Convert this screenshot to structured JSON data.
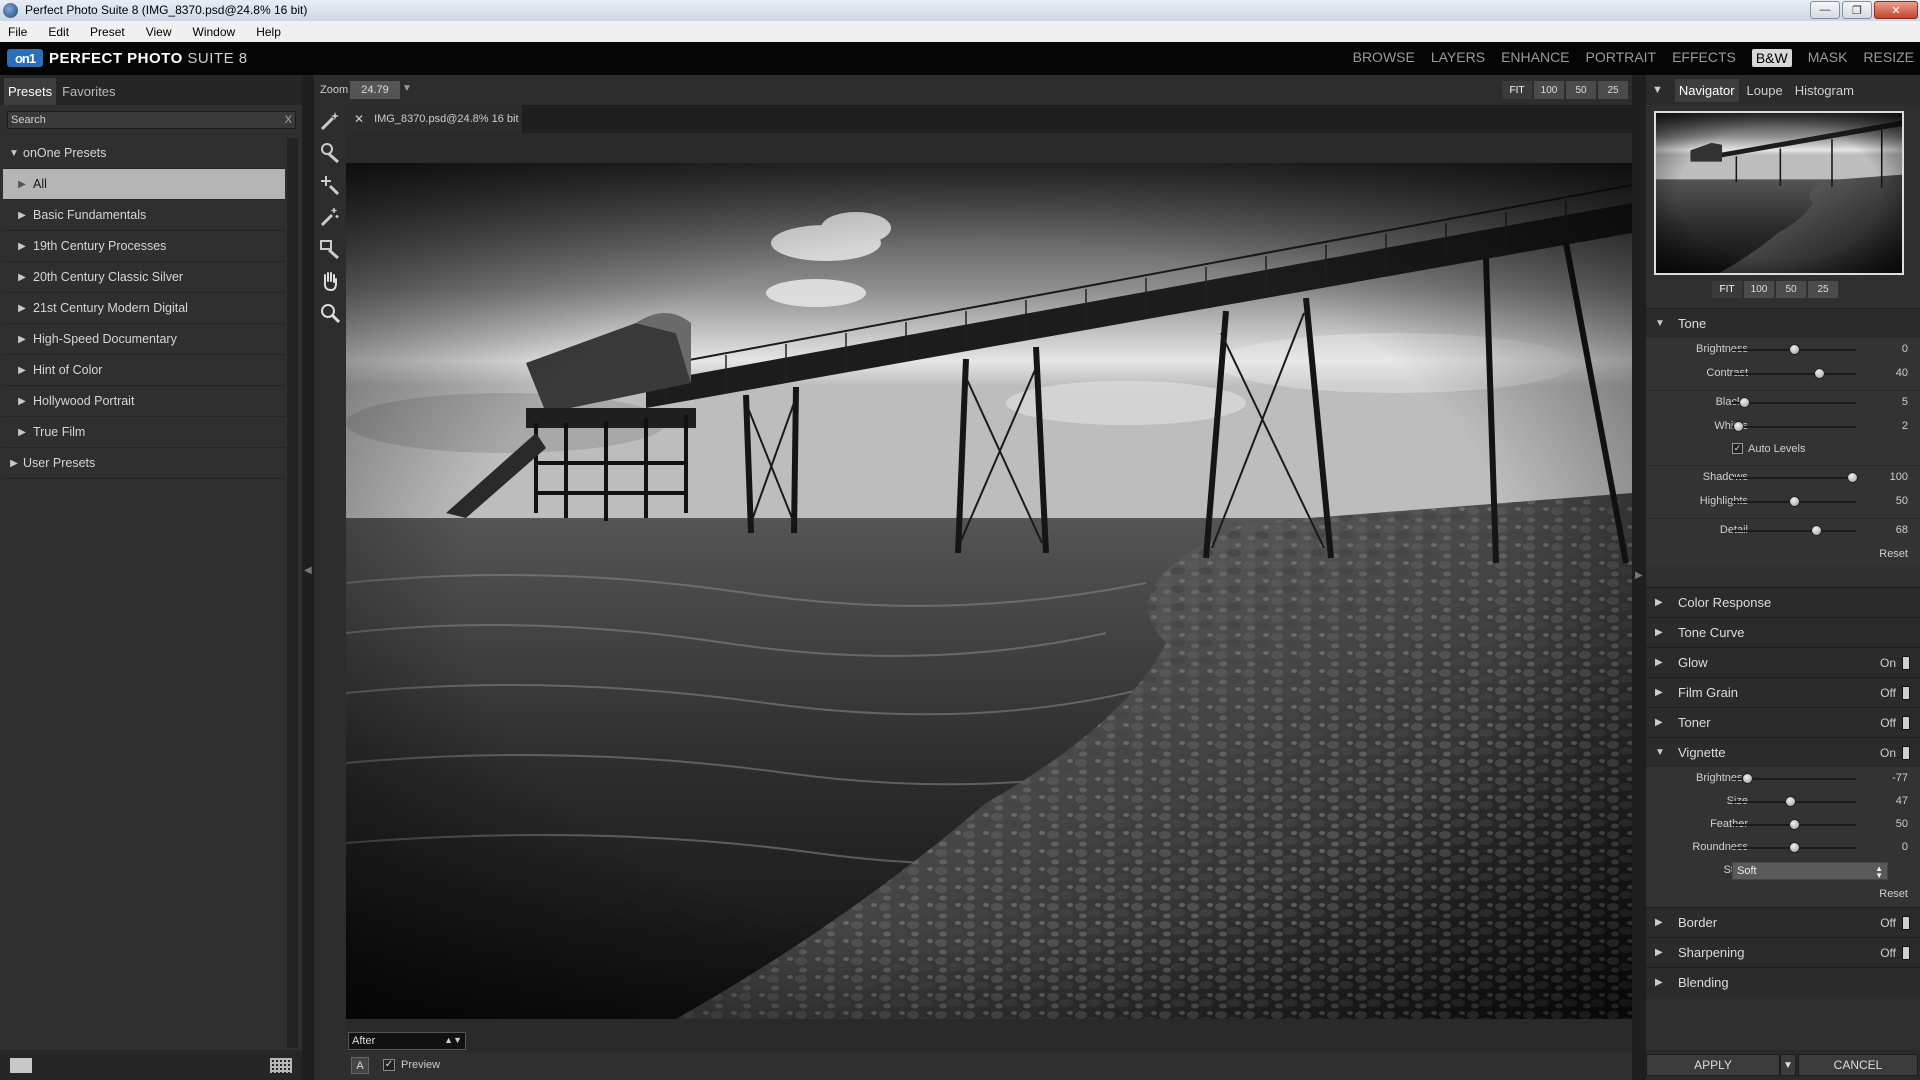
{
  "window": {
    "title": "Perfect Photo Suite 8 (IMG_8370.psd@24.8% 16 bit)"
  },
  "menu": [
    "File",
    "Edit",
    "Preset",
    "View",
    "Window",
    "Help"
  ],
  "app": {
    "logo_mark": "on1",
    "name_bold": "PERFECT PHOTO",
    "name_light": " SUITE 8",
    "modules": [
      "BROWSE",
      "LAYERS",
      "ENHANCE",
      "PORTRAIT",
      "EFFECTS",
      "B&W",
      "MASK",
      "RESIZE"
    ],
    "active_module": "B&W"
  },
  "left": {
    "tabs": [
      "Presets",
      "Favorites"
    ],
    "search_placeholder": "Search",
    "search_clear": "X",
    "root": "onOne Presets",
    "items": [
      "All",
      "Basic Fundamentals",
      "19th Century Processes",
      "20th Century Classic Silver",
      "21st Century Modern Digital",
      "High-Speed Documentary",
      "Hint of Color",
      "Hollywood Portrait",
      "True Film"
    ],
    "user": "User Presets"
  },
  "canvas": {
    "zoom_label": "Zoom",
    "zoom_value": "24.79",
    "zoom_buttons": [
      "FIT",
      "100",
      "50",
      "25"
    ],
    "doc_tab": "IMG_8370.psd@24.8% 16 bit",
    "view_mode": "After",
    "compare_label": "A",
    "preview_label": "Preview"
  },
  "navigator": {
    "tabs": [
      "Navigator",
      "Loupe",
      "Histogram"
    ],
    "zoom_buttons": [
      "FIT",
      "100",
      "50",
      "25"
    ]
  },
  "tone": {
    "title": "Tone",
    "brightness": {
      "label": "Brightness",
      "value": "0",
      "pos": 0.5
    },
    "contrast": {
      "label": "Contrast",
      "value": "40",
      "pos": 0.7
    },
    "blacks": {
      "label": "Blacks",
      "value": "5",
      "pos": 0.1
    },
    "whites": {
      "label": "Whites",
      "value": "2",
      "pos": 0.05
    },
    "auto_levels": "Auto Levels",
    "shadows": {
      "label": "Shadows",
      "value": "100",
      "pos": 0.97
    },
    "highlights": {
      "label": "Highlights",
      "value": "50",
      "pos": 0.5
    },
    "detail": {
      "label": "Detail",
      "value": "68",
      "pos": 0.68
    },
    "reset": "Reset"
  },
  "sections": {
    "color_response": "Color Response",
    "tone_curve": "Tone Curve",
    "glow": {
      "title": "Glow",
      "state": "On"
    },
    "film_grain": {
      "title": "Film Grain",
      "state": "Off"
    },
    "toner": {
      "title": "Toner",
      "state": "Off"
    },
    "vignette": {
      "title": "Vignette",
      "state": "On"
    },
    "border": {
      "title": "Border",
      "state": "Off"
    },
    "sharpening": {
      "title": "Sharpening",
      "state": "Off"
    },
    "blending": "Blending"
  },
  "vignette": {
    "brightness": {
      "label": "Brightness",
      "value": "-77",
      "pos": 0.12
    },
    "size": {
      "label": "Size",
      "value": "47",
      "pos": 0.47
    },
    "feather": {
      "label": "Feather",
      "value": "50",
      "pos": 0.5
    },
    "roundness": {
      "label": "Roundness",
      "value": "0",
      "pos": 0.5
    },
    "style_label": "Style",
    "style_value": "Soft",
    "reset": "Reset"
  },
  "actions": {
    "apply": "APPLY",
    "cancel": "CANCEL"
  }
}
